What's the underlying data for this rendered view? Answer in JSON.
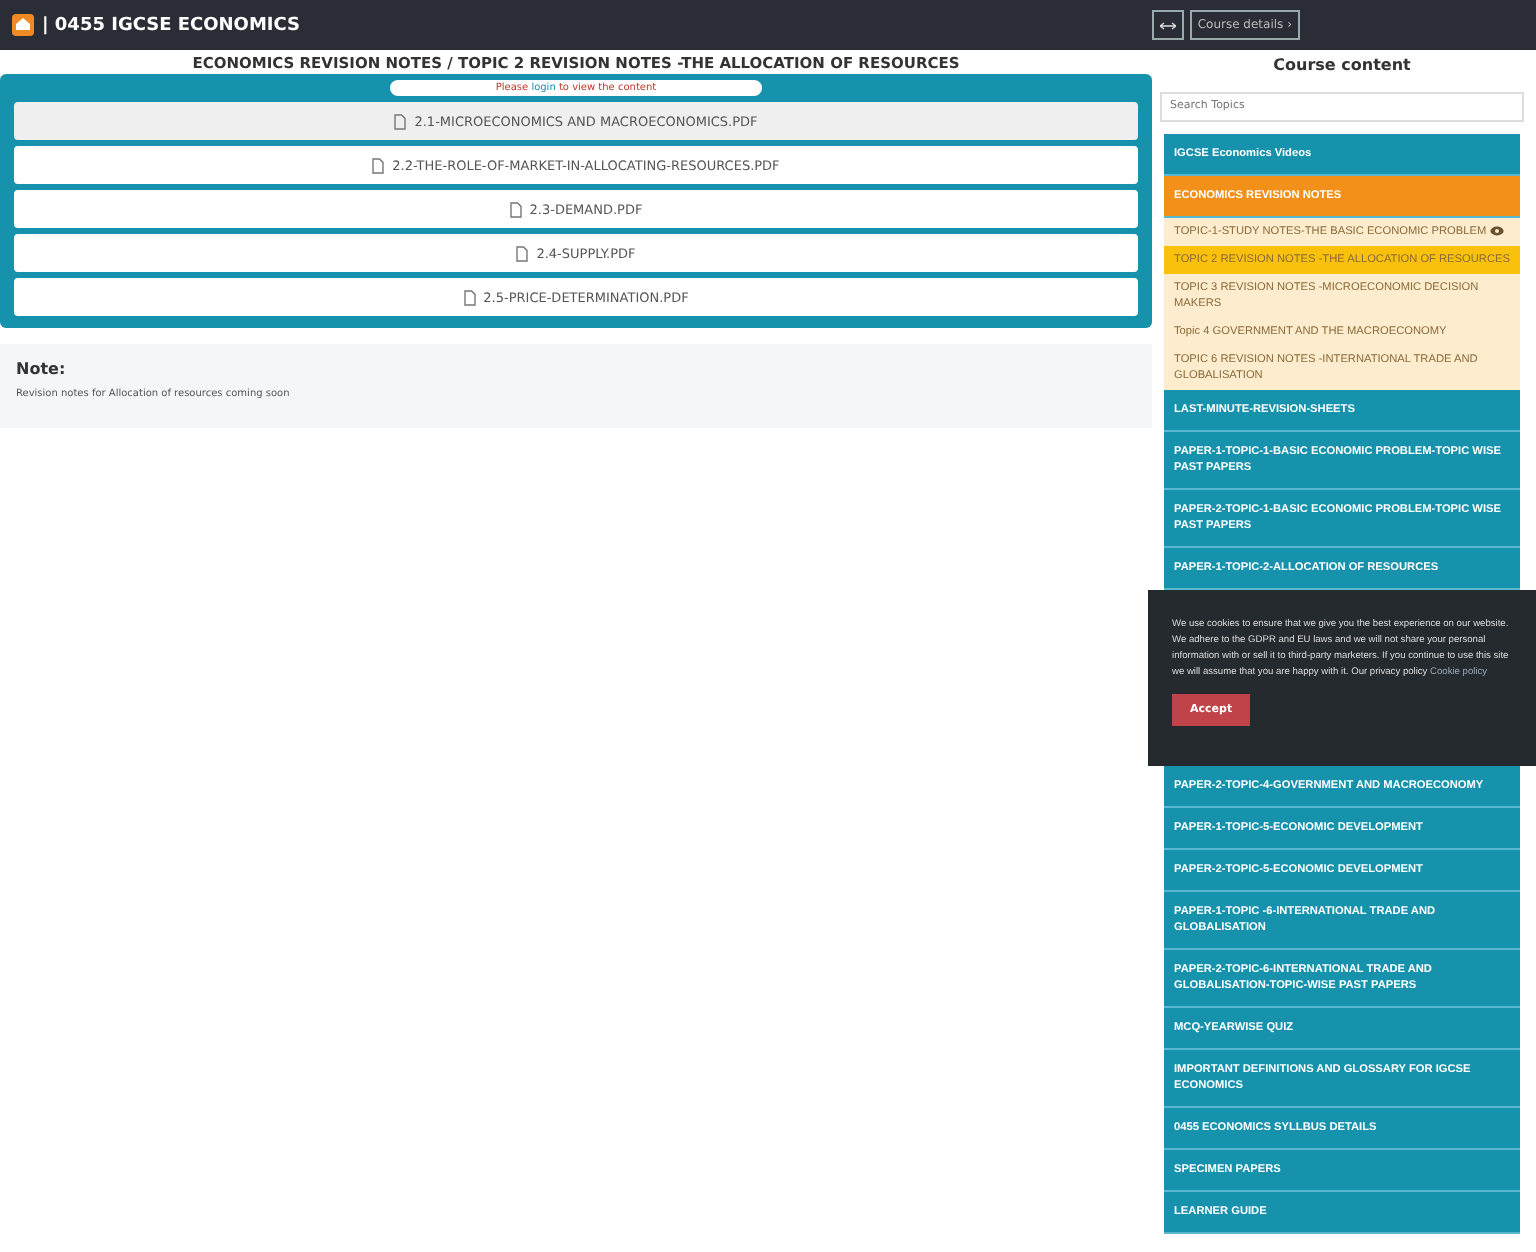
{
  "topbar": {
    "title": "| 0455 IGCSE ECONOMICS",
    "course_button": "Course details",
    "chevron": "›"
  },
  "page_title": "ECONOMICS REVISION NOTES / TOPIC 2 REVISION NOTES -THE ALLOCATION OF RESOURCES",
  "login_notice": {
    "before": "Please",
    "link": "login",
    "after": "to view the content"
  },
  "files": [
    {
      "name": "2.1-MICROECONOMICS AND MACROECONOMICS.PDF",
      "highlighted": true
    },
    {
      "name": "2.2-THE-ROLE-OF-MARKET-IN-ALLOCATING-RESOURCES.PDF",
      "highlighted": false
    },
    {
      "name": "2.3-DEMAND.PDF",
      "highlighted": false
    },
    {
      "name": "2.4-SUPPLY.PDF",
      "highlighted": false
    },
    {
      "name": "2.5-PRICE-DETERMINATION.PDF",
      "highlighted": false
    }
  ],
  "note": {
    "title": "Note:",
    "text": "Revision notes for Allocation of resources coming soon"
  },
  "sidebar": {
    "title": "Course content",
    "search": {
      "placeholder": "Search Topics"
    },
    "items": [
      {
        "kind": "section",
        "label": "IGCSE Economics Videos"
      },
      {
        "kind": "open",
        "label": "ECONOMICS REVISION NOTES"
      },
      {
        "kind": "sub",
        "label": "TOPIC-1-STUDY NOTES-THE BASIC ECONOMIC PROBLEM",
        "selected": false,
        "preview": true
      },
      {
        "kind": "sub",
        "label": "TOPIC 2 REVISION NOTES -THE ALLOCATION OF RESOURCES",
        "selected": true,
        "preview": false
      },
      {
        "kind": "sub",
        "label": "TOPIC 3 REVISION NOTES -MICROECONOMIC DECISION MAKERS",
        "selected": false,
        "preview": false
      },
      {
        "kind": "sub",
        "label": "Topic 4 GOVERNMENT AND THE MACROECONOMY",
        "selected": false,
        "preview": false
      },
      {
        "kind": "sub",
        "label": "TOPIC 6 REVISION NOTES -INTERNATIONAL TRADE AND GLOBALISATION",
        "selected": false,
        "preview": false
      },
      {
        "kind": "section",
        "label": "LAST-MINUTE-REVISION-SHEETS"
      },
      {
        "kind": "section",
        "label": "PAPER-1-TOPIC-1-BASIC ECONOMIC PROBLEM-TOPIC WISE PAST PAPERS"
      },
      {
        "kind": "section",
        "label": "PAPER-2-TOPIC-1-BASIC ECONOMIC PROBLEM-TOPIC WISE PAST PAPERS"
      },
      {
        "kind": "section",
        "label": "PAPER-1-TOPIC-2-ALLOCATION OF RESOURCES"
      },
      {
        "kind": "covered"
      },
      {
        "kind": "section",
        "label": "PAPER-2-TOPIC-4-GOVERNMENT AND MACROECONOMY"
      },
      {
        "kind": "section",
        "label": "PAPER-1-TOPIC-5-ECONOMIC DEVELOPMENT"
      },
      {
        "kind": "section",
        "label": "PAPER-2-TOPIC-5-ECONOMIC DEVELOPMENT"
      },
      {
        "kind": "section",
        "label": "PAPER-1-TOPIC -6-INTERNATIONAL TRADE AND GLOBALISATION"
      },
      {
        "kind": "section",
        "label": "PAPER-2-TOPIC-6-INTERNATIONAL TRADE AND GLOBALISATION-TOPIC-WISE PAST PAPERS"
      },
      {
        "kind": "section",
        "label": "MCQ-YEARWISE QUIZ"
      },
      {
        "kind": "section",
        "label": "IMPORTANT DEFINITIONS AND GLOSSARY FOR IGCSE ECONOMICS"
      },
      {
        "kind": "section",
        "label": "0455 ECONOMICS SYLLBUS DETAILS"
      },
      {
        "kind": "section",
        "label": "SPECIMEN PAPERS"
      },
      {
        "kind": "section",
        "label": "LEARNER GUIDE"
      }
    ]
  },
  "cookie": {
    "text": "We use cookies to ensure that we give you the best experience on our website. We adhere to the GDPR and EU laws and we will not share your personal information with or sell it to third-party marketers. If you continue to use this site we will assume that you are happy with it. Our privacy policy",
    "link": "Cookie policy",
    "button": "Accept"
  }
}
